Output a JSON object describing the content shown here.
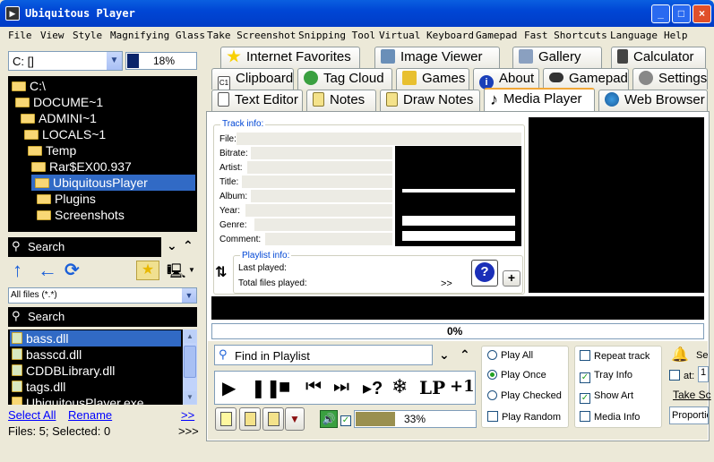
{
  "window": {
    "title": "Ubiquitous Player",
    "min": "_",
    "max": "□",
    "close": "×"
  },
  "menu": [
    "File",
    "View",
    "Style",
    "Magnifying Glass",
    "Take Screenshot",
    "Snipping Tool",
    "Virtual Keyboard",
    "Gamepad",
    "Fast Shortcuts",
    "Language",
    "Help"
  ],
  "drive": {
    "value": "C: []",
    "percent": "18%"
  },
  "tree": [
    "C:\\",
    "DOCUME~1",
    "ADMINI~1",
    "LOCALS~1",
    "Temp",
    "Rar$EX00.937",
    "UbiquitousPlayer",
    "Plugins",
    "Screenshots"
  ],
  "search1": {
    "placeholder": "Search"
  },
  "filter": {
    "value": "All files (*.*)"
  },
  "search2": {
    "placeholder": "Search"
  },
  "files": [
    "bass.dll",
    "basscd.dll",
    "CDDBLibrary.dll",
    "tags.dll",
    "UbiquitousPlayer.exe"
  ],
  "bottom_links": {
    "select_all": "Select All",
    "rename": "Rename",
    "more": ">>",
    "status": "Files: 5; Selected: 0",
    "more2": ">>>"
  },
  "tabs_row1": [
    "Internet Favorites",
    "Image Viewer",
    "Gallery",
    "Calculator"
  ],
  "tabs_row2": [
    "Clipboard",
    "Tag Cloud",
    "Games",
    "About",
    "Gamepad",
    "Settings"
  ],
  "tabs_row3": [
    "Text Editor",
    "Notes",
    "Draw Notes",
    "Media Player",
    "Web Browser"
  ],
  "track": {
    "legend": "Track info:",
    "labels": [
      "File:",
      "Bitrate:",
      "Artist:",
      "Title:",
      "Album:",
      "Year:",
      "Genre:",
      "Comment:"
    ]
  },
  "playlist": {
    "legend": "Playlist info:",
    "last_played": "Last played:",
    "total_played": "Total files played:",
    "arrows": ">>",
    "help": "?",
    "plus": "+"
  },
  "progress": "0%",
  "find": {
    "placeholder": "Find in Playlist"
  },
  "controls": {
    "lp": "LP",
    "plus1": "+1",
    "help": "?"
  },
  "volume": "33%",
  "play_modes": [
    "Play All",
    "Play Once",
    "Play Checked",
    "Play Random"
  ],
  "checks": [
    "Repeat track",
    "Tray Info",
    "Show Art",
    "Media Info"
  ],
  "right_panel": {
    "se": "Se",
    "at": "at:",
    "at_value": "1",
    "take": "Take Sc",
    "proportion": "Proportio"
  },
  "colors": {
    "title_bar": "#0046d5",
    "selection": "#316ac5",
    "link": "#0000ff",
    "accent_tab": "#f1a737"
  }
}
